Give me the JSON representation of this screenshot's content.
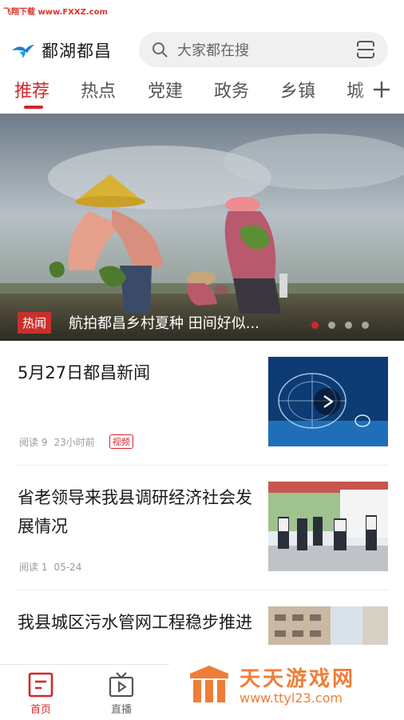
{
  "watermark_top": "飞翔下载 www.FXXZ.com",
  "header": {
    "app_name": "鄱湖都昌",
    "search_placeholder": "大家都在搜"
  },
  "tabs": [
    {
      "label": "推荐",
      "active": true
    },
    {
      "label": "热点"
    },
    {
      "label": "党建"
    },
    {
      "label": "政务"
    },
    {
      "label": "乡镇"
    },
    {
      "label": "城"
    }
  ],
  "banner": {
    "badge": "热闻",
    "title": "航拍都昌乡村夏种 田间好似...",
    "dot_count": 4,
    "active_dot": 0
  },
  "feed": [
    {
      "title": "5月27日都昌新闻",
      "reads": "阅读 9",
      "time": "23小时前",
      "tag": "视频",
      "thumb_icon": "play-icon"
    },
    {
      "title": "省老领导来我县调研经济社会发展情况",
      "reads": "阅读 1",
      "time": "05-24"
    },
    {
      "title": "我县城区污水管网工程稳步推进"
    }
  ],
  "bottom_nav": [
    {
      "label": "首页",
      "icon": "home-icon",
      "active": true
    },
    {
      "label": "直播",
      "icon": "tv-icon"
    }
  ],
  "watermark_bottom": {
    "title": "天天游戏网",
    "url": "www.ttyl23.com"
  },
  "colors": {
    "accent": "#d3272c",
    "watermark": "#f07d36"
  }
}
